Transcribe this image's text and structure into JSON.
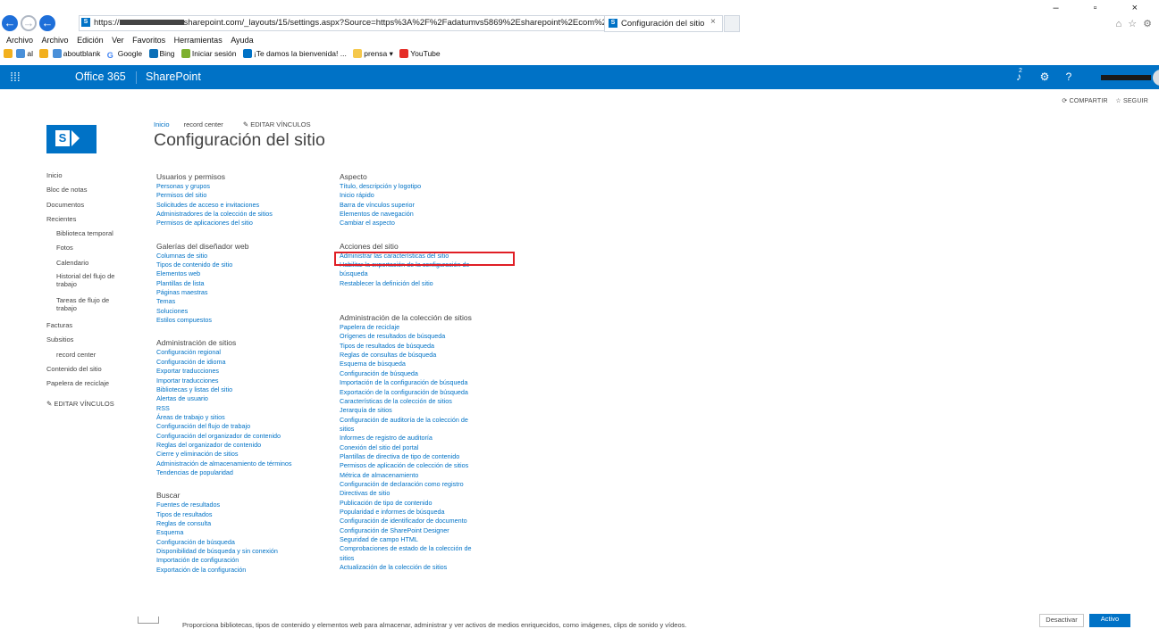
{
  "browser": {
    "url_prefix": "https://",
    "url_suffix": "sharepoint.com/_layouts/15/settings.aspx?Source=https%3A%2F%2Fadatumvs5869%2Esharepoint%2Ecom%2FSitePages%2",
    "addr_icons": "⌕ ▾ 🔒 ⟲ ⟳",
    "tab_title": "Configuración del sitio",
    "tab_close": "×",
    "window_controls": "– ▫ ×",
    "right_icons": "⌂ ☆ ⚙",
    "menu": [
      "Archivo",
      "Archivo",
      "Edición",
      "Ver",
      "Favoritos",
      "Herramientas",
      "Ayuda"
    ],
    "favorites": [
      "al",
      "aboutblank",
      "Google",
      "Bing",
      "Iniciar sesión",
      "¡Te damos la bienvenida! ...",
      "prensa ▾",
      "YouTube"
    ]
  },
  "suite": {
    "waffle": "⋮⋮⋮",
    "office": "Office 365",
    "product": "SharePoint",
    "bell_badge": "2",
    "bell_icon": "♪",
    "gear_icon": "⚙",
    "help_icon": "?"
  },
  "share": {
    "share": "⟳ COMPARTIR",
    "follow": "☆ SEGUIR"
  },
  "header": {
    "nav_home": "Inicio",
    "nav_rc": "record center",
    "nav_edit": "✎ EDITAR VÍNCULOS",
    "title": "Configuración del sitio",
    "logo_letter": "S"
  },
  "leftnav": {
    "items": [
      {
        "label": "Inicio",
        "sub": false
      },
      {
        "label": "Bloc de notas",
        "sub": false
      },
      {
        "label": "Documentos",
        "sub": false
      },
      {
        "label": "Recientes",
        "sub": false
      },
      {
        "label": "Biblioteca temporal",
        "sub": true
      },
      {
        "label": "Fotos",
        "sub": true
      },
      {
        "label": "Calendario",
        "sub": true
      },
      {
        "label": "Historial del flujo de trabajo",
        "sub": true
      },
      {
        "label": "Tareas de flujo de trabajo",
        "sub": true
      },
      {
        "label": "Facturas",
        "sub": false
      },
      {
        "label": "Subsitios",
        "sub": false
      },
      {
        "label": "record center",
        "sub": true
      },
      {
        "label": "Contenido del sitio",
        "sub": false
      },
      {
        "label": "Papelera de reciclaje",
        "sub": false
      }
    ],
    "edit": "✎ EDITAR VÍNCULOS"
  },
  "col1": [
    {
      "title": "Usuarios y permisos",
      "links": [
        "Personas y grupos",
        "Permisos del sitio",
        "Solicitudes de acceso e invitaciones",
        "Administradores de la colección de sitios",
        "Permisos de aplicaciones del sitio"
      ]
    },
    {
      "title": "Galerías del diseñador web",
      "links": [
        "Columnas de sitio",
        "Tipos de contenido de sitio",
        "Elementos web",
        "Plantillas de lista",
        "Páginas maestras",
        "Temas",
        "Soluciones",
        "Estilos compuestos"
      ]
    },
    {
      "title": "Administración de sitios",
      "links": [
        "Configuración regional",
        "Configuración de idioma",
        "Exportar traducciones",
        "Importar traducciones",
        "Bibliotecas y listas del sitio",
        "Alertas de usuario",
        "RSS",
        "Áreas de trabajo y sitios",
        "Configuración del flujo de trabajo",
        "Configuración del organizador de contenido",
        "Reglas del organizador de contenido",
        "Cierre y eliminación de sitios",
        "Administración de almacenamiento de términos",
        "Tendencias de popularidad"
      ]
    },
    {
      "title": "Buscar",
      "links": [
        "Fuentes de resultados",
        "Tipos de resultados",
        "Reglas de consulta",
        "Esquema",
        "Configuración de búsqueda",
        "Disponibilidad de búsqueda y sin conexión",
        "Importación de configuración",
        "Exportación de la configuración"
      ]
    }
  ],
  "col2": [
    {
      "title": "Aspecto",
      "links": [
        "Título, descripción y logotipo",
        "Inicio rápido",
        "Barra de vínculos superior",
        "Elementos de navegación",
        "Cambiar el aspecto"
      ]
    },
    {
      "title": "Acciones del sitio",
      "links": [
        "Administrar las características del sitio",
        "Habilitar la exportación de la configuración de búsqueda",
        "Restablecer la definición del sitio"
      ]
    },
    {
      "title": "Administración de la colección de sitios",
      "links": [
        "Papelera de reciclaje",
        "Orígenes de resultados de búsqueda",
        "Tipos de resultados de búsqueda",
        "Reglas de consultas de búsqueda",
        "Esquema de búsqueda",
        "Configuración de búsqueda",
        "Importación de la configuración de búsqueda",
        "Exportación de la configuración de búsqueda",
        "Características de la colección de sitios",
        "Jerarquía de sitios",
        "Configuración de auditoría de la colección de sitios",
        "Informes de registro de auditoría",
        "Conexión del sitio del portal",
        "Plantillas de directiva de tipo de contenido",
        "Permisos de aplicación de colección de sitios",
        "Métrica de almacenamiento",
        "Configuración de declaración como registro",
        "Directivas de sitio",
        "Publicación de tipo de contenido",
        "Popularidad e informes de búsqueda",
        "Configuración de identificador de documento",
        "Configuración de SharePoint Designer",
        "Seguridad de campo HTML",
        "Comprobaciones de estado de la colección de sitios",
        "Actualización de la colección de sitios"
      ]
    }
  ],
  "bottom": {
    "description": "Proporciona bibliotecas, tipos de contenido y elementos web para almacenar, administrar y ver activos de medios enriquecidos, como imágenes, clips de sonido y vídeos.",
    "deactivate": "Desactivar",
    "activate": "Activo"
  }
}
